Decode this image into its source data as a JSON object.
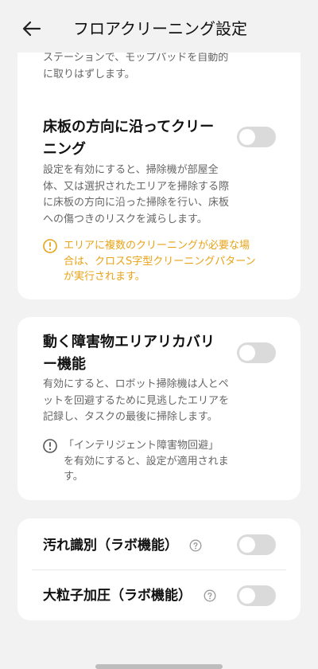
{
  "header": {
    "title": "フロアクリーニング設定",
    "back_icon": "back-arrow-icon"
  },
  "colors": {
    "background": "#f2f2f2",
    "card": "#ffffff",
    "warning": "#e8a317",
    "toggle_off": "#dadada"
  },
  "card1": {
    "top_desc": [
      "ステーションで、モップパッドを自動的",
      "に取りはずします。"
    ],
    "setting": {
      "title": [
        "床板の方向に沿ってクリー",
        "ニング"
      ],
      "toggle_on": false,
      "desc": [
        "設定を有効にすると、掃除機が部屋全",
        "体、又は選択されたエリアを掃除する際",
        "に床板の方向に沿った掃除を行い、床板",
        "への傷つきのリスクを減らします。"
      ],
      "warning_icon": "warning-circle-icon",
      "warning": [
        "エリアに複数のクリーニングが必要な場",
        "合は、クロスS字型クリーニングパターン",
        "が実行されます。"
      ]
    }
  },
  "card2": {
    "title": [
      "動く障害物エリアリカバリ",
      "ー機能"
    ],
    "toggle_on": false,
    "desc": [
      "有効にすると、ロボット掃除機は人とペ",
      "ットを回避するために見逃したエリアを",
      "記録し、タスクの最後に掃除します。"
    ],
    "info_icon": "info-circle-icon",
    "info": [
      "「インテリジェント障害物回避」",
      "を有効にすると、設定が適用されま",
      "す。"
    ]
  },
  "card3": {
    "rows": [
      {
        "label": "汚れ識別（ラボ機能）",
        "toggle_on": false,
        "icon": "help-circle-icon"
      },
      {
        "label": "大粒子加圧（ラボ機能）",
        "toggle_on": false,
        "icon": "help-circle-icon"
      }
    ]
  }
}
